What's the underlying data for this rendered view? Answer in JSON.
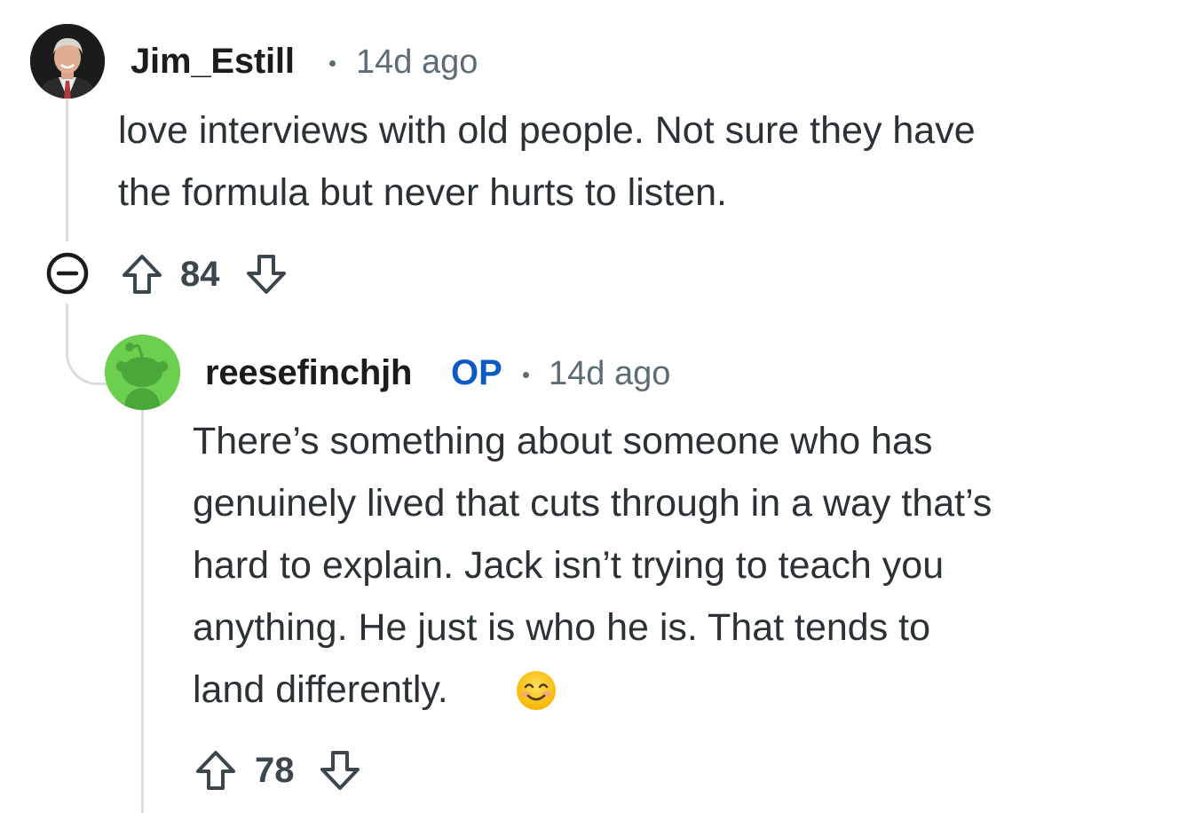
{
  "comments": [
    {
      "author": "Jim_Estill",
      "separator": "•",
      "timestamp": "14d ago",
      "body_lines": [
        "love interviews with old people. Not sure they have",
        "the formula but never hurts to listen."
      ],
      "score": "84",
      "avatar_icon": "profile-photo-avatar",
      "collapse_icon": "collapse-minus-icon"
    },
    {
      "author": "reesefinchjh",
      "badge": "OP",
      "separator": "•",
      "timestamp": "14d ago",
      "body_lines": [
        "There’s something about someone who has",
        "genuinely lived that cuts through in a way that’s",
        "hard to explain. Jack isn’t trying to teach you",
        "anything. He just is who he is. That tends to",
        "land differently."
      ],
      "emoji": "😊",
      "score": "78",
      "avatar_icon": "snoo-avatar"
    }
  ],
  "colors": {
    "text": "#1c1c1c",
    "body_text": "#2a3236",
    "meta": "#5c6c74",
    "op_badge": "#0a5bc4",
    "thread_line": "#d9dde0",
    "snoo_green": "#6ccf4f"
  }
}
